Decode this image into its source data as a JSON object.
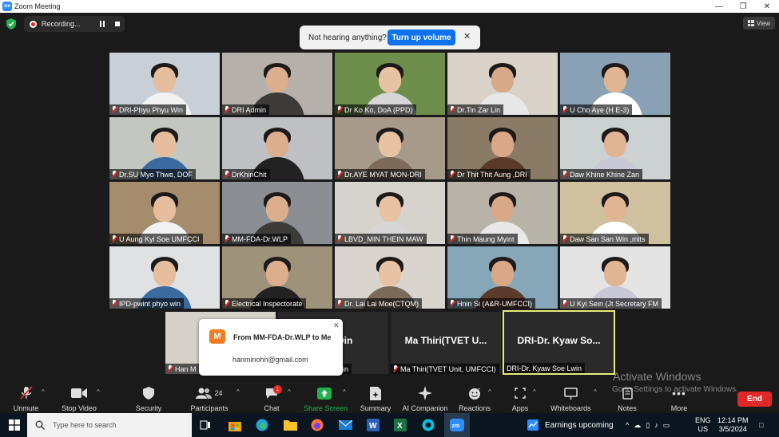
{
  "window": {
    "title": "Zoom Meeting",
    "logo": "zm"
  },
  "recording": {
    "label": "Recording..."
  },
  "audio_notice": {
    "message": "Not hearing anything?",
    "button": "Turn up volume"
  },
  "view_button": {
    "label": "View"
  },
  "participants": [
    {
      "name": "DRI-Phyu Phyu Win",
      "bg": "#c9cfd6"
    },
    {
      "name": "DRI Admin",
      "bg": "#b5b0aa"
    },
    {
      "name": "Dr Ko Ko,  DoA (PPD)",
      "bg": "#6d8f4b"
    },
    {
      "name": "Dr.Tin Zar Lin",
      "bg": "#d8d2c8"
    },
    {
      "name": "U Cho Aye  (H E-3)",
      "bg": "#8aa1b5"
    },
    {
      "name": "Dr.SU Myo Thwe, DOF",
      "bg": "#c4c6c2"
    },
    {
      "name": "DrKhinChit",
      "bg": "#bfc0c4"
    },
    {
      "name": "Dr.AYE MYAT MON-DRI",
      "bg": "#a79a8a"
    },
    {
      "name": "Dr Thit Thit Aung ,DRI",
      "bg": "#8a7b66"
    },
    {
      "name": "Daw Khine Khine Zan",
      "bg": "#ccd2d2"
    },
    {
      "name": "U Aung Kyi Soe UMFCCI",
      "bg": "#a48c6d"
    },
    {
      "name": "MM-FDA-Dr.WLP",
      "bg": "#8b8e93"
    },
    {
      "name": "LBVD_MIN THEIN MAW",
      "bg": "#d6d3cd"
    },
    {
      "name": "Thin Maung Myint",
      "bg": "#b7b3a9"
    },
    {
      "name": "Daw San San Win ,mits",
      "bg": "#cfc0a0"
    },
    {
      "name": "IPD-pwint phyo win",
      "bg": "#dfe1e3"
    },
    {
      "name": "Electrical Inspectorate",
      "bg": "#9f927b"
    },
    {
      "name": "Dr. Lai Lai Moe(CTQM)",
      "bg": "#d9d4cd"
    },
    {
      "name": "Hnin Si (A&R-UMFCCI)",
      "bg": "#86a7b8"
    },
    {
      "name": "U Kyi Sein (Jt Secretary FM",
      "bg": "#e4e4e4"
    }
  ],
  "bottom_row": {
    "han_tile": {
      "name": "Han M"
    },
    "din_tile": {
      "title": "in Din",
      "name": "in"
    },
    "mathiri_tile": {
      "title": "Ma Thiri(TVET U...",
      "name": "Ma Thiri(TVET Unit, UMFCCI)"
    },
    "kyaw_tile": {
      "title": "DRI-Dr. Kyaw So...",
      "name": "DRI-Dr. Kyaw Soe Lwin"
    }
  },
  "chat_toast": {
    "avatar": "M",
    "from": "From MM-FDA-Dr.WLP to Me",
    "email": "hanminohn@gmail.com"
  },
  "watermark": {
    "line1": "Activate Windows",
    "line2": "Go to Settings to activate Windows."
  },
  "toolbar": {
    "unmute": "Unmute",
    "stop_video": "Stop Video",
    "security": "Security",
    "participants": "Participants",
    "participants_count": "24",
    "chat": "Chat",
    "chat_badge": "1",
    "share_screen": "Share Screen",
    "summary": "Summary",
    "ai_companion": "AI Companion",
    "reactions": "Reactions",
    "apps": "Apps",
    "whiteboards": "Whiteboards",
    "notes": "Notes",
    "more": "More",
    "end": "End",
    "share_color": "#23b14d",
    "end_color": "#e02828"
  },
  "taskbar": {
    "search_placeholder": "Type here to search",
    "weather": "Earnings upcoming",
    "lang": "ENG",
    "region": "US",
    "time": "12:14 PM",
    "date": "3/5/2024"
  }
}
